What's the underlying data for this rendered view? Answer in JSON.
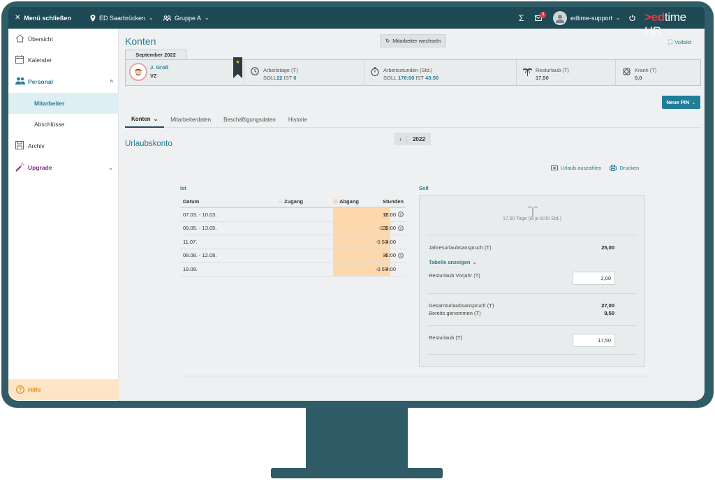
{
  "topbar": {
    "menu_close": "Menü schließen",
    "location": "ED Saarbrücken",
    "group": "Gruppe A",
    "sigma": "Σ",
    "mail_badge": "3",
    "user": "edtime-support",
    "logo_ed": ">ed",
    "logo_rest": "time HR"
  },
  "sidebar": {
    "items": [
      {
        "label": "Übersicht"
      },
      {
        "label": "Kalender"
      },
      {
        "label": "Personal"
      },
      {
        "label": "Mitarbeiter"
      },
      {
        "label": "Abschlüsse"
      },
      {
        "label": "Archiv"
      },
      {
        "label": "Upgrade"
      }
    ],
    "help": "Hilfe"
  },
  "main": {
    "title": "Konten",
    "switch_employee": "Mitarbeiter wechseln",
    "fullscreen": "Vollbild",
    "month": "September 2022",
    "employee": {
      "name": "J. Groß",
      "type": "VZ"
    },
    "stats": {
      "workdays_label": "Arbeitstage (T)",
      "workdays_soll_label": "SOLL",
      "workdays_soll": "22",
      "workdays_ist_label": "IST",
      "workdays_ist": "6",
      "hours_label": "Arbeitsstunden (Std.)",
      "hours_soll_label": "SOLL",
      "hours_soll": "176:00",
      "hours_ist_label": "IST",
      "hours_ist": "43:50",
      "rest_label": "Resturlaub (T)",
      "rest_value": "17,50",
      "sick_label": "Krank (T)",
      "sick_value": "0,0"
    },
    "new_pin": "Neue PIN",
    "tabs": [
      "Konten",
      "Mitarbeiterdaten",
      "Beschäftigungsdaten",
      "Historie"
    ],
    "section_title": "Urlaubskonto",
    "year": "2022",
    "actions": {
      "payout": "Urlaub auszahlen",
      "print": "Drucken"
    }
  },
  "ist": {
    "label": "Ist",
    "headers": {
      "date": "Datum",
      "in": "Zugang",
      "out": "Abgang",
      "hours": "Stunden"
    },
    "rows": [
      {
        "date": "07.03. - 10.03.",
        "out": "-2",
        "hours": "16:00",
        "info": true
      },
      {
        "date": "09.05. - 13.05.",
        "out": "-2.5",
        "hours": "20:00",
        "info": true
      },
      {
        "date": "11.07.",
        "out": "-0.50",
        "hours": "4:00",
        "info": false
      },
      {
        "date": "08.08. - 12.08.",
        "out": "-4",
        "hours": "32:00",
        "info": true
      },
      {
        "date": "19.08.",
        "out": "-0.50",
        "hours": "4:00",
        "info": false
      }
    ],
    "colors": {
      "abgang": "#fdd8ad",
      "zugang": "#dfe8ea"
    }
  },
  "soll": {
    "label": "Soll",
    "days_note": "17,50 Tage (Ø je 8:00 Std.)",
    "annual_label": "Jahresurlaubsanspruch (T)",
    "annual_value": "25,00",
    "show_table": "Tabelle anzeigen",
    "prev_year_label": "Resturlaub Vorjahr (T)",
    "prev_year_value": "2,00",
    "total_label": "Gesamturlaubsanspruch (T)",
    "total_value": "27,00",
    "taken_label": "Bereits genommen (T)",
    "taken_value": "9,50",
    "rest_label": "Resturlaub (T)",
    "rest_value": "17,50"
  },
  "accent": "#237e97",
  "dark": "#1e4a55"
}
